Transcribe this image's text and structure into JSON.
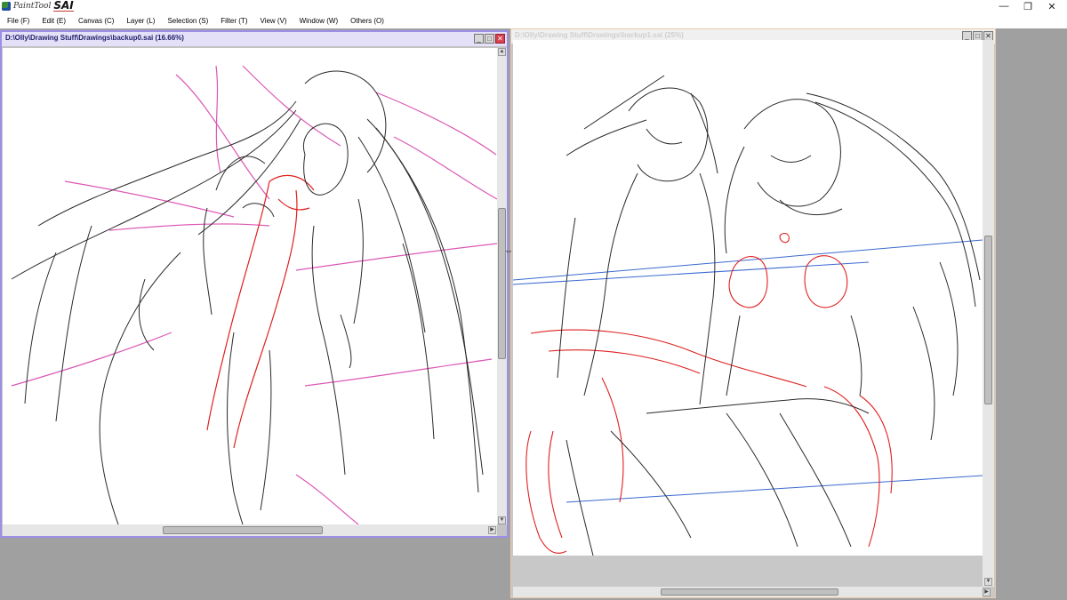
{
  "app": {
    "logo_small": "PaintTool",
    "logo_big": "SAI",
    "window_controls": {
      "minimize": "—",
      "restore": "❐",
      "close": "✕"
    }
  },
  "menu": [
    {
      "label": "File (F)"
    },
    {
      "label": "Edit (E)"
    },
    {
      "label": "Canvas (C)"
    },
    {
      "label": "Layer (L)"
    },
    {
      "label": "Selection (S)"
    },
    {
      "label": "Filter (T)"
    },
    {
      "label": "View (V)"
    },
    {
      "label": "Window (W)"
    },
    {
      "label": "Others (O)"
    }
  ],
  "documents": [
    {
      "title": "D:\\Olly\\Drawing Stuff\\Drawings\\backup0.sai (16.66%)",
      "active": true,
      "buttons": {
        "minimize": "_",
        "maximize": "□",
        "close": "✕"
      }
    },
    {
      "title": "D:\\Olly\\Drawing Stuff\\Drawings\\backup1.sai (25%)",
      "active": false,
      "buttons": {
        "minimize": "_",
        "maximize": "□",
        "close": "✕"
      }
    }
  ],
  "colors": {
    "workspace": "#a0a0a0",
    "active_frame": "#9b8fe6",
    "inactive_frame": "#c8c8c8",
    "sketch_black": "#2a2a2a",
    "sketch_magenta": "#d63aa8",
    "sketch_red": "#e02020",
    "sketch_blue": "#3a6ad0"
  }
}
